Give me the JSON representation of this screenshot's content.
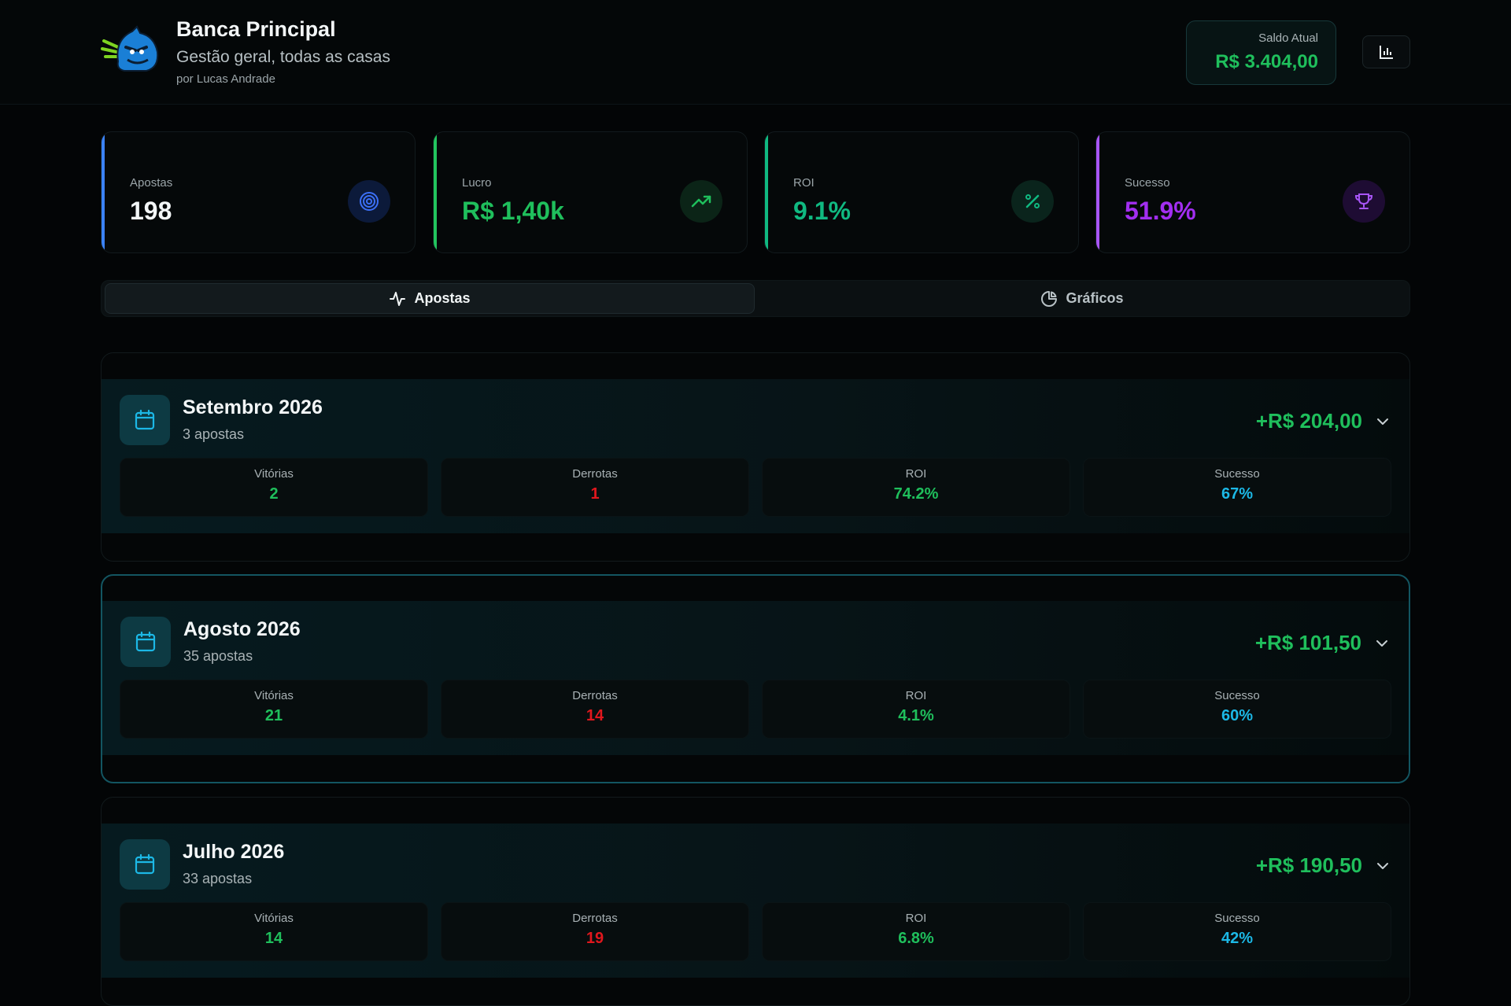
{
  "header": {
    "title": "Banca Principal",
    "subtitle": "Gestão geral, todas as casas",
    "author": "por Lucas Andrade",
    "balance_label": "Saldo Atual",
    "balance_value": "R$ 3.404,00"
  },
  "stats": [
    {
      "label": "Apostas",
      "value": "198",
      "icon": "target-icon",
      "accent": "#3b82f6",
      "value_color": "#f3f6f7"
    },
    {
      "label": "Lucro",
      "value": "R$ 1,40k",
      "icon": "trending-up-icon",
      "accent": "#22c55e",
      "value_color": "#1fbf5c"
    },
    {
      "label": "ROI",
      "value": "9.1%",
      "icon": "percent-icon",
      "accent": "#10b981",
      "value_color": "#10b981"
    },
    {
      "label": "Sucesso",
      "value": "51.9%",
      "icon": "trophy-icon",
      "accent": "#a855f7",
      "value_color": "#a22ef0"
    }
  ],
  "tabs": {
    "apostas": "Apostas",
    "graficos": "Gráficos"
  },
  "months": [
    {
      "title": "Setembro 2026",
      "count": "3 apostas",
      "total": "+R$ 204,00",
      "metrics": [
        {
          "label": "Vitórias",
          "value": "2"
        },
        {
          "label": "Derrotas",
          "value": "1"
        },
        {
          "label": "ROI",
          "value": "74.2%"
        },
        {
          "label": "Sucesso",
          "value": "67%"
        }
      ]
    },
    {
      "title": "Agosto 2026",
      "count": "35 apostas",
      "total": "+R$ 101,50",
      "metrics": [
        {
          "label": "Vitórias",
          "value": "21"
        },
        {
          "label": "Derrotas",
          "value": "14"
        },
        {
          "label": "ROI",
          "value": "4.1%"
        },
        {
          "label": "Sucesso",
          "value": "60%"
        }
      ]
    },
    {
      "title": "Julho 2026",
      "count": "33 apostas",
      "total": "+R$ 190,50",
      "metrics": [
        {
          "label": "Vitórias",
          "value": "14"
        },
        {
          "label": "Derrotas",
          "value": "19"
        },
        {
          "label": "ROI",
          "value": "6.8%"
        },
        {
          "label": "Sucesso",
          "value": "42%"
        }
      ]
    }
  ]
}
